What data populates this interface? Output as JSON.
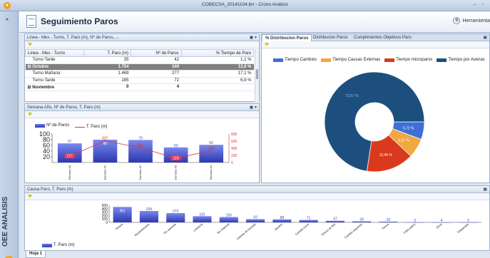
{
  "window": {
    "title": "COBECSA_20141104.brr - Crono Análisis",
    "controls": "– ▫"
  },
  "sidebar": {
    "arrow": "»",
    "label": "OEE ANALISIS",
    "warn": "!"
  },
  "header": {
    "title": "Seguimiento Paros",
    "tools_label": "Herramienta"
  },
  "table_panel": {
    "title": "Linea - Mes - Turno, T. Paro (m), Nº de Paros, ...",
    "controls": "▣ ▾",
    "columns": [
      "Linea - Mes - Turno",
      "T. Paro (m)",
      "Nº de Paros",
      "% Tiempo de Paro"
    ],
    "rows": [
      {
        "label": "Turno Tarde",
        "t_paro": "35",
        "paros": "42",
        "pct": "1,1 %",
        "style": ""
      },
      {
        "label": "⊟ Octubre",
        "t_paro": "1.754",
        "paros": "349",
        "pct": "13,8 %",
        "style": "sel"
      },
      {
        "label": "Turno Mañana",
        "t_paro": "1.469",
        "paros": "277",
        "pct": "17,1 %",
        "style": ""
      },
      {
        "label": "Turno Tarde",
        "t_paro": "285",
        "paros": "72",
        "pct": "6,9 %",
        "style": ""
      },
      {
        "label": "⊟ Noviembre",
        "t_paro": "0",
        "paros": "4",
        "pct": "",
        "style": "bold"
      }
    ]
  },
  "week_panel": {
    "title": "Semana Año, Nº de Paros, T. Paro (m)",
    "controls": "▣ ▾",
    "legend": [
      "Nº de Paros",
      "T. Paro (m)"
    ]
  },
  "tabs_panel": {
    "tabs": [
      "% Distribucion Paros",
      "Distribucion Paros",
      "Cumplimientos Objetivos Paro"
    ],
    "controls": "▣",
    "legend": [
      {
        "label": "Tiempo Cambios",
        "color": "#3d6fd6"
      },
      {
        "label": "Tiempo Causas Externas",
        "color": "#f2a740"
      },
      {
        "label": "Tiempo microparos",
        "color": "#d9391c"
      },
      {
        "label": "Tiempo por Averias",
        "color": "#1c4f7d"
      }
    ]
  },
  "cause_panel": {
    "title": "Causa Paro, T. Paro (m)",
    "controls": "▣",
    "legend": [
      "T. Paro (m)"
    ]
  },
  "sheet_tab": "Hoja 1",
  "colors": {
    "accent": "#3b4cd0",
    "line": "#e03030"
  },
  "chart_data": [
    {
      "type": "bar",
      "categories": [
        "Semana 40",
        "Semana 41",
        "Semana 42",
        "Semana 43",
        "Semana 44"
      ],
      "series": [
        {
          "name": "Nº de Paros",
          "values": [
            67,
            80,
            79,
            53,
            62
          ]
        },
        {
          "name": "T. Paro (m)",
          "values": [
            177,
            607,
            415,
            119,
            333
          ]
        }
      ],
      "data_labels_bar": [
        "67",
        "",
        "79",
        "53",
        "62"
      ],
      "data_labels_line": [
        "177",
        "607",
        "415",
        "119",
        "333"
      ],
      "bar_inner_labels": [
        "",
        "80",
        "",
        "",
        ""
      ],
      "ylim": [
        0,
        100
      ],
      "yticks": [
        "100",
        "80",
        "60",
        "40",
        "20"
      ],
      "y2lim": [
        0,
        800
      ],
      "y2ticks": [
        "800",
        "600",
        "400",
        "200",
        "0"
      ],
      "legend": "top-left"
    },
    {
      "type": "pie",
      "labels": [
        "Tiempo Cambios",
        "Tiempo Causas Externas",
        "Tiempo microparos",
        "Tiempo por Averias"
      ],
      "values": [
        5.72,
        6.31,
        15.4,
        72.57
      ],
      "value_labels": [
        "5,72 %",
        "6,31 %",
        "15,40 %",
        "72,57 %"
      ],
      "donut": true,
      "legend": "top"
    },
    {
      "type": "bar",
      "categories": [
        "Rotura",
        "Mantenimiento",
        "Sin operario",
        "Limpieza",
        "Sin material",
        "Cambio de formato",
        "Ajustes",
        "Cambio turno",
        "Rotura de film",
        "Cambio etiquetas",
        "Pausa",
        "Falta palets",
        "Otros",
        "Etiquetado"
      ],
      "values": [
        451,
        334,
        270,
        181,
        156,
        93,
        88,
        71,
        47,
        30,
        20,
        5,
        4,
        3
      ],
      "data_labels": [
        "451",
        "334",
        "270",
        "181",
        "156",
        "93",
        "88",
        "71",
        "47",
        "30",
        "20",
        "5",
        "4",
        "3"
      ],
      "ylim": [
        0,
        500
      ],
      "yticks": [
        "500",
        "400",
        "300",
        "200",
        "100",
        "0"
      ],
      "legend": "bottom-left"
    }
  ]
}
